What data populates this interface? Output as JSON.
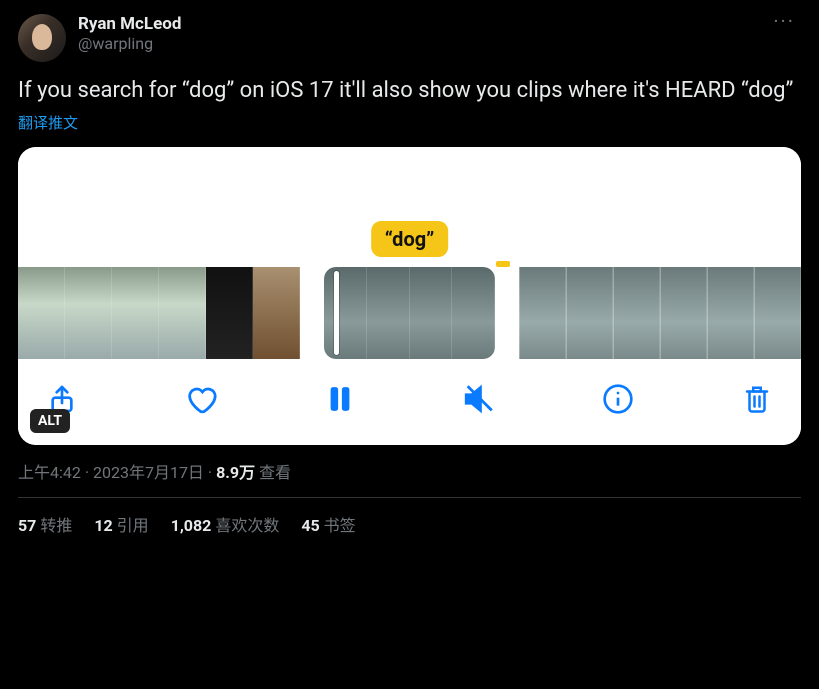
{
  "author": {
    "display_name": "Ryan McLeod",
    "handle": "@warpling"
  },
  "tweet_text": "If you search for “dog” on iOS 17 it'll also show you clips where it's HEARD “dog”",
  "translate_label": "翻译推文",
  "media": {
    "caption_label": "“dog”",
    "alt_badge": "ALT",
    "toolbar": {
      "share": "share",
      "like": "like",
      "pause": "pause",
      "mute": "mute",
      "info": "info",
      "delete": "delete"
    }
  },
  "meta": {
    "time": "上午4:42",
    "date": "2023年7月17日",
    "views_count": "8.9万",
    "views_label": "查看",
    "separator": " · "
  },
  "stats": {
    "retweets": {
      "count": "57",
      "label": "转推"
    },
    "quotes": {
      "count": "12",
      "label": "引用"
    },
    "likes": {
      "count": "1,082",
      "label": "喜欢次数"
    },
    "bookmarks": {
      "count": "45",
      "label": "书签"
    }
  },
  "more_glyph": "···"
}
